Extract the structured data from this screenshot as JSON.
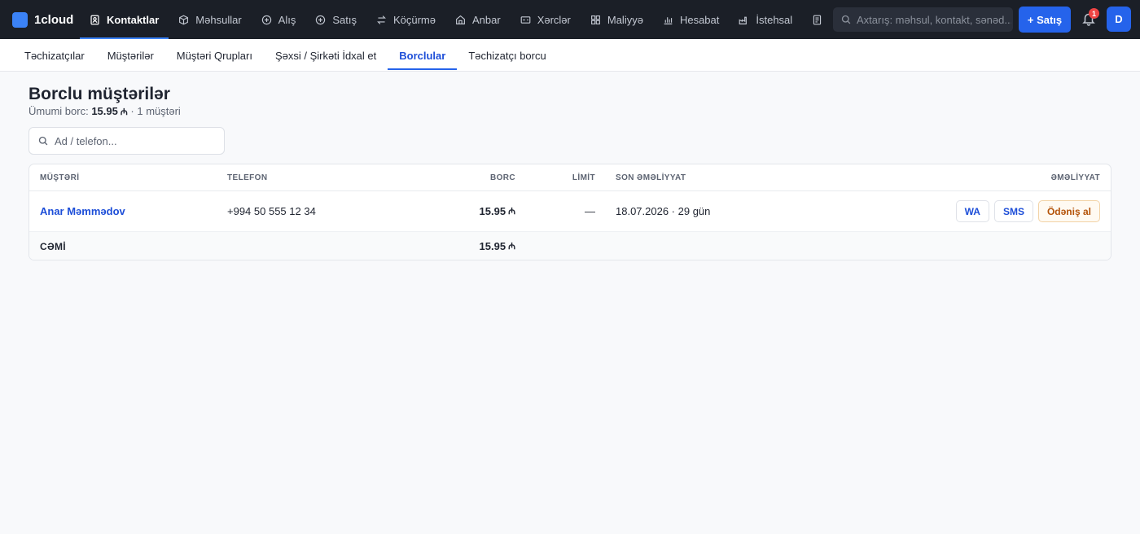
{
  "app": {
    "name": "1cloud",
    "accent": "#3b82f6"
  },
  "nav": [
    {
      "label": "Kontaktlar",
      "icon": "contacts-icon",
      "active": true
    },
    {
      "label": "Məhsullar",
      "icon": "box-icon"
    },
    {
      "label": "Alış",
      "icon": "plus-circle-icon"
    },
    {
      "label": "Satış",
      "icon": "plus-circle-icon"
    },
    {
      "label": "Köçürmə",
      "icon": "transfer-icon"
    },
    {
      "label": "Anbar",
      "icon": "warehouse-icon"
    },
    {
      "label": "Xərclər",
      "icon": "expense-icon"
    },
    {
      "label": "Maliyyə",
      "icon": "grid-icon"
    },
    {
      "label": "Hesabat",
      "icon": "bar-chart-icon"
    },
    {
      "label": "İstehsal",
      "icon": "factory-icon"
    },
    {
      "label": "",
      "icon": "document-icon"
    }
  ],
  "search": {
    "placeholder": "Axtarış: məhsul, kontakt, sənəd..."
  },
  "new_sale_label": "+ Satış",
  "notifications": {
    "count": "1"
  },
  "user": {
    "initial": "D"
  },
  "subnav": [
    {
      "label": "Təchizatçılar"
    },
    {
      "label": "Müştərilər"
    },
    {
      "label": "Müştəri Qrupları"
    },
    {
      "label": "Şəxsi / Şirkəti İdxal et"
    },
    {
      "label": "Borclular",
      "active": true
    },
    {
      "label": "Təchizatçı borcu"
    }
  ],
  "page": {
    "title": "Borclu müştərilər",
    "total_prefix": "Ümumi borc:",
    "total_amount": "15.95",
    "currency": "₼",
    "count_text": "· 1 müştəri"
  },
  "filter": {
    "placeholder": "Ad / telefon..."
  },
  "table": {
    "columns": {
      "customer": "MÜŞTƏRİ",
      "phone": "TELEFON",
      "debt": "BORC",
      "limit": "LİMİT",
      "last_op": "SON ƏMƏLİYYAT",
      "action": "ƏMƏLİYYAT"
    },
    "rows": [
      {
        "name": "Anar Məmmədov",
        "phone": "+994 50 555 12 34",
        "debt": "15.95",
        "limit": "—",
        "last_op": "18.07.2026 · 29 gün",
        "actions": {
          "wa": "WA",
          "sms": "SMS",
          "pay": "Ödəniş al"
        }
      }
    ],
    "total": {
      "label": "CƏMİ",
      "debt": "15.95"
    }
  }
}
